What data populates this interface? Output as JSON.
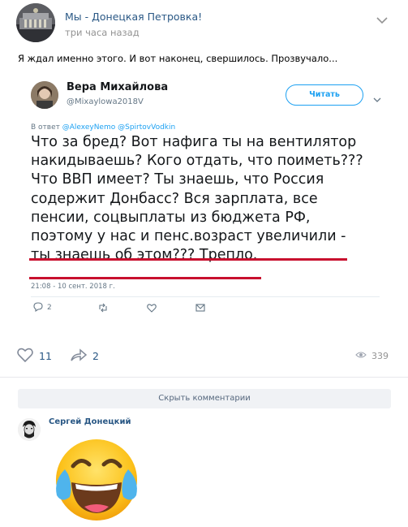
{
  "post": {
    "author": "Мы - Донецкая Петровка!",
    "time": "три часа назад",
    "text": "Я ждал именно этого. И вот наконец, свершилось. Прозвучало..."
  },
  "tweet": {
    "name": "Вера Михайлова",
    "handle": "@Mixaylowa2018V",
    "follow_label": "Читать",
    "reply_prefix": "В ответ",
    "reply_to": [
      "@AlexeyNemo",
      "@SpirtovVodkin"
    ],
    "body_lines": [
      "Что за бред? Вот нафига ты на вентилятор",
      "накидываешь? Кого отдать, что поиметь???",
      "Что ВВП имеет? Ты знаешь, что Россия",
      "содержит Донбасс? Вся зарплата, все",
      "пенсии, соцвыплаты из бюджета РФ,",
      "поэтому у нас и пенс.возраст увеличили -",
      "ты знаешь об этом??? Трепло."
    ],
    "date": "21:08 - 10 сент. 2018 г.",
    "replies": "2",
    "accent": "#1da1f2",
    "underline_color": "#c8102e"
  },
  "footer": {
    "likes": "11",
    "shares": "2",
    "views": "339"
  },
  "comments": {
    "hide_label": "Скрыть комментарии",
    "items": [
      {
        "author": "Сергей Донецкий",
        "content": "face-with-tears-of-joy-emoji"
      }
    ]
  },
  "colors": {
    "link": "#2a5885",
    "muted": "#939393"
  }
}
